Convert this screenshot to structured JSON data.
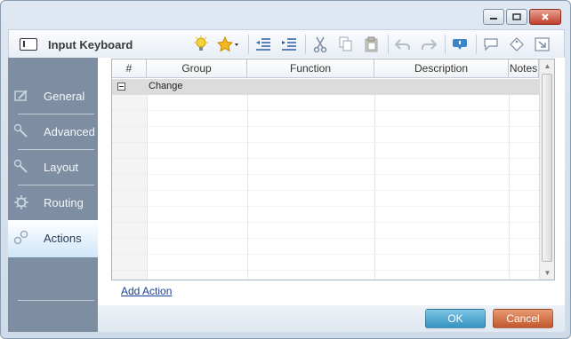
{
  "window": {
    "title": "Input Keyboard",
    "controls": [
      "minimize",
      "maximize",
      "close"
    ]
  },
  "toolbar": {
    "icons": [
      "lightbulb-icon",
      "star-icon",
      "outdent-icon",
      "indent-icon",
      "cut-icon",
      "copy-icon",
      "paste-icon",
      "undo-icon",
      "redo-icon",
      "comment-icon",
      "speech-bubble-icon",
      "tag-icon",
      "export-icon"
    ]
  },
  "sidebar": {
    "items": [
      {
        "label": "General",
        "icon": "edit-icon",
        "active": false
      },
      {
        "label": "Advanced",
        "icon": "wrench-icon",
        "active": false
      },
      {
        "label": "Layout",
        "icon": "wrench-icon",
        "active": false
      },
      {
        "label": "Routing",
        "icon": "gear-icon",
        "active": false
      },
      {
        "label": "Actions",
        "icon": "gears-icon",
        "active": true
      }
    ]
  },
  "grid": {
    "columns": [
      "#",
      "Group",
      "Function",
      "Description",
      "Notes"
    ],
    "group_row": {
      "label": "Change"
    }
  },
  "add_action_label": "Add Action",
  "buttons": {
    "ok": "OK",
    "cancel": "Cancel"
  },
  "colors": {
    "sidebar": "#7d8ea2",
    "ok": "#3593c2",
    "cancel": "#c3582d",
    "link": "#1a3f9c"
  }
}
